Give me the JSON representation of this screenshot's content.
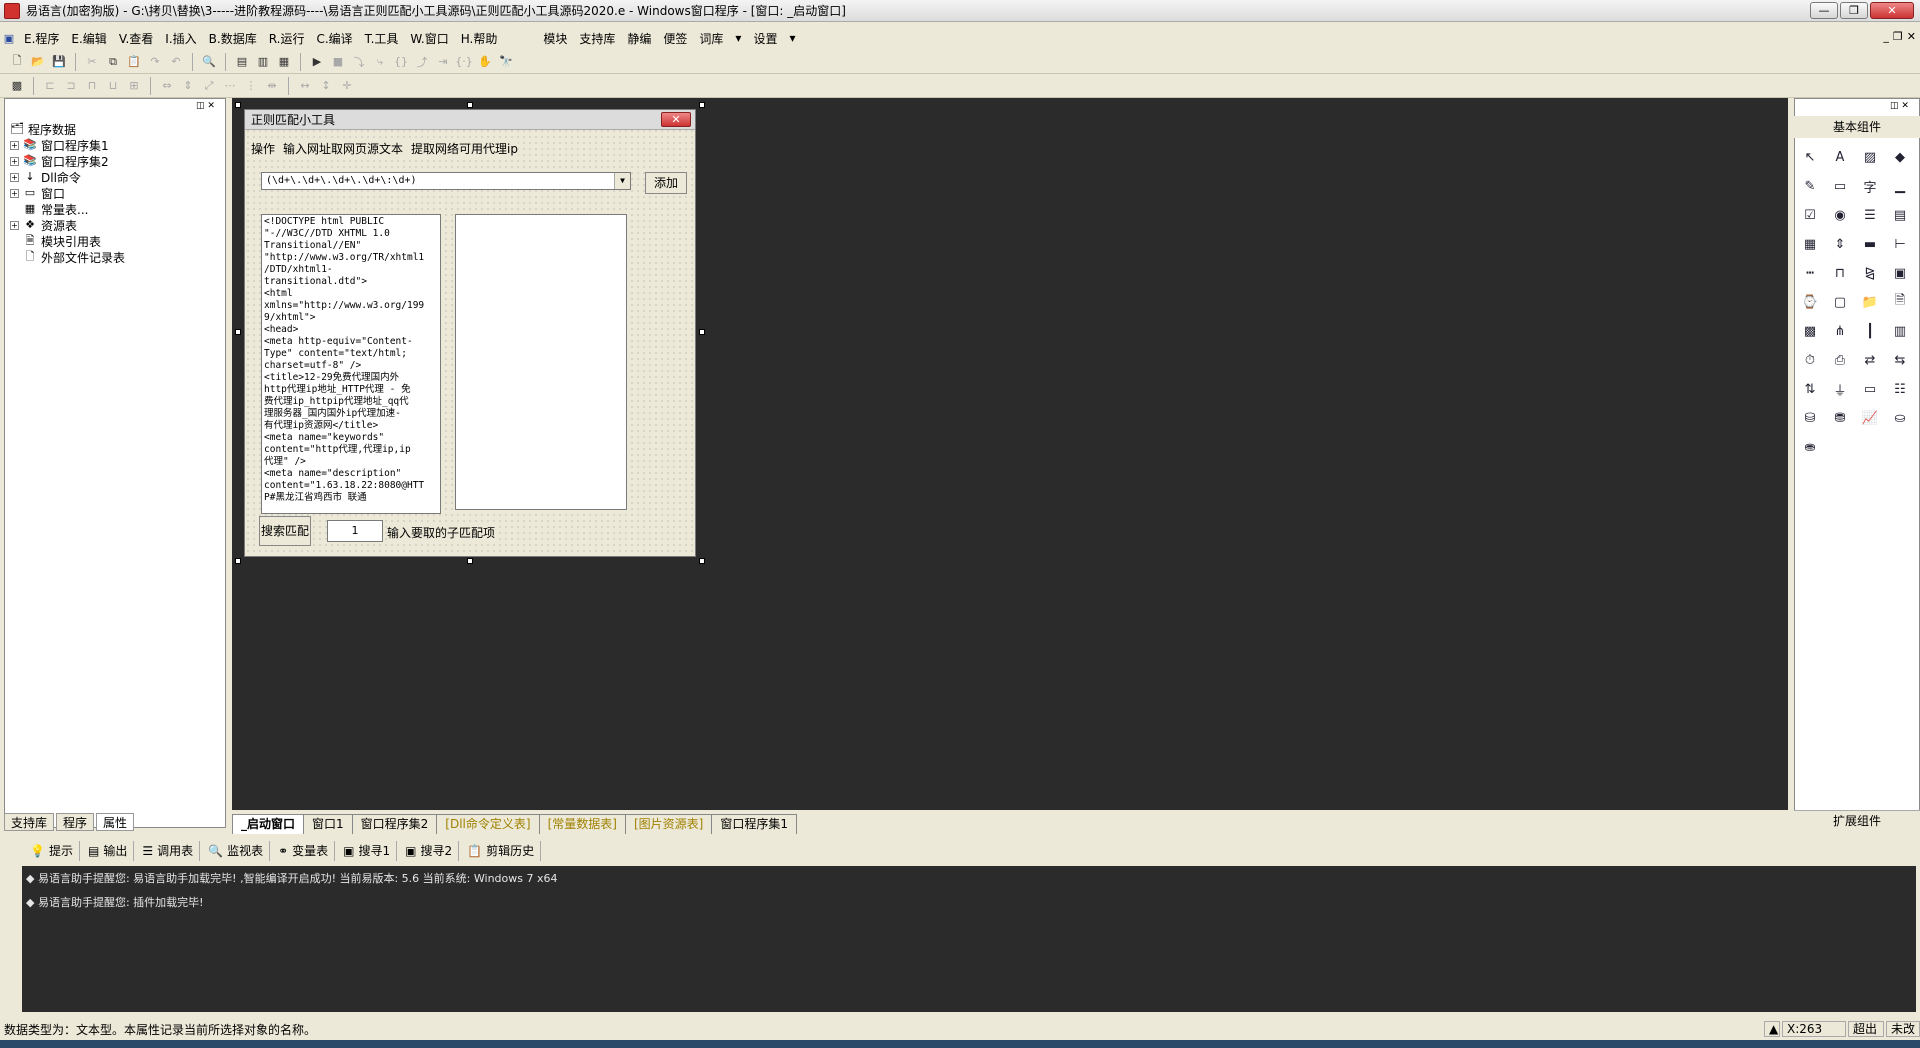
{
  "title": "易语言(加密狗版) - G:\\拷贝\\替换\\3-----进阶教程源码----\\易语言正则匹配小工具源码\\正则匹配小工具源码2020.e - Windows窗口程序 - [窗口: _启动窗口]",
  "menu": [
    "E.程序",
    "E.编辑",
    "V.查看",
    "I.插入",
    "B.数据库",
    "R.运行",
    "C.编译",
    "T.工具",
    "W.窗口",
    "H.帮助"
  ],
  "menu_extra": [
    "模块",
    "支持库",
    "静编",
    "便签",
    "词库",
    "设置"
  ],
  "tree": {
    "root": "程序数据",
    "items": [
      "窗口程序集1",
      "窗口程序集2",
      "Dll命令",
      "窗口",
      "常量表...",
      "资源表",
      "模块引用表",
      "外部文件记录表"
    ]
  },
  "left_tabs": [
    "支持库",
    "程序",
    "属性"
  ],
  "doc_tabs": [
    "_启动窗口",
    "窗口1",
    "窗口程序集2",
    "[Dll命令定义表]",
    "[常量数据表]",
    "[图片资源表]",
    "窗口程序集1"
  ],
  "design": {
    "caption": "正则匹配小工具",
    "menu": [
      "操作",
      "输入网址取网页源文本",
      "提取网络可用代理ip"
    ],
    "combo_value": "(\\d+\\.\\d+\\.\\d+\\.\\d+\\:\\d+)",
    "add_label": "添加",
    "source_text": "<!DOCTYPE html PUBLIC\n\"-//W3C//DTD XHTML 1.0\nTransitional//EN\"\n\"http://www.w3.org/TR/xhtml1\n/DTD/xhtml1-\ntransitional.dtd\">\n<html\nxmlns=\"http://www.w3.org/199\n9/xhtml\">\n<head>\n<meta http-equiv=\"Content-\nType\" content=\"text/html;\ncharset=utf-8\" />\n<title>12-29免费代理国内外\nhttp代理ip地址_HTTP代理 - 免\n费代理ip_httpip代理地址_qq代\n理服务器_国内国外ip代理加速-\n有代理ip资源网</title>\n<meta name=\"keywords\"\ncontent=\"http代理,代理ip,ip\n代理\" />\n<meta name=\"description\"\ncontent=\"1.63.18.22:8080@HTT\nP#黑龙江省鸡西市 联通",
    "search_label": "搜索匹配",
    "number_value": "1",
    "number_label": "输入要取的子匹配项"
  },
  "right_panel": {
    "header": "基本组件",
    "footer": "扩展组件"
  },
  "right_icons": [
    "pointer-icon",
    "label-icon",
    "image-icon",
    "shape-icon",
    "edit-icon",
    "frame-icon",
    "text-icon",
    "line-icon",
    "checkbox-icon",
    "radio-icon",
    "listbox-icon",
    "combobox-icon",
    "table-icon",
    "scroll-icon",
    "progress-icon",
    "slider-icon",
    "ruler-icon",
    "tabs-icon",
    "slider2-icon",
    "calendar-icon",
    "datetime-icon",
    "tray-icon",
    "folder-icon",
    "file-icon",
    "grid-icon",
    "tree-icon",
    "divider-icon",
    "panel-icon",
    "clock-icon",
    "printer-icon",
    "net-icon",
    "socket-icon",
    "transfer-icon",
    "funnel-icon",
    "window-icon",
    "list2-icon",
    "db-icon",
    "dbtable-icon",
    "chart-icon",
    "odbc-icon",
    "odbc2-icon"
  ],
  "bottom_tabs": [
    "提示",
    "输出",
    "调用表",
    "监视表",
    "变量表",
    "搜寻1",
    "搜寻2",
    "剪辑历史"
  ],
  "output": [
    "易语言助手提醒您: 易语言助手加载完毕! ,智能编译开启成功! 当前易版本: 5.6 当前系统: Windows 7 x64",
    "易语言助手提醒您: 插件加载完毕!"
  ],
  "status": {
    "message": "数据类型为：文本型。本属性记录当前所选择对象的名称。",
    "coord": "X:263",
    "mode": "超出",
    "save": "未改"
  }
}
